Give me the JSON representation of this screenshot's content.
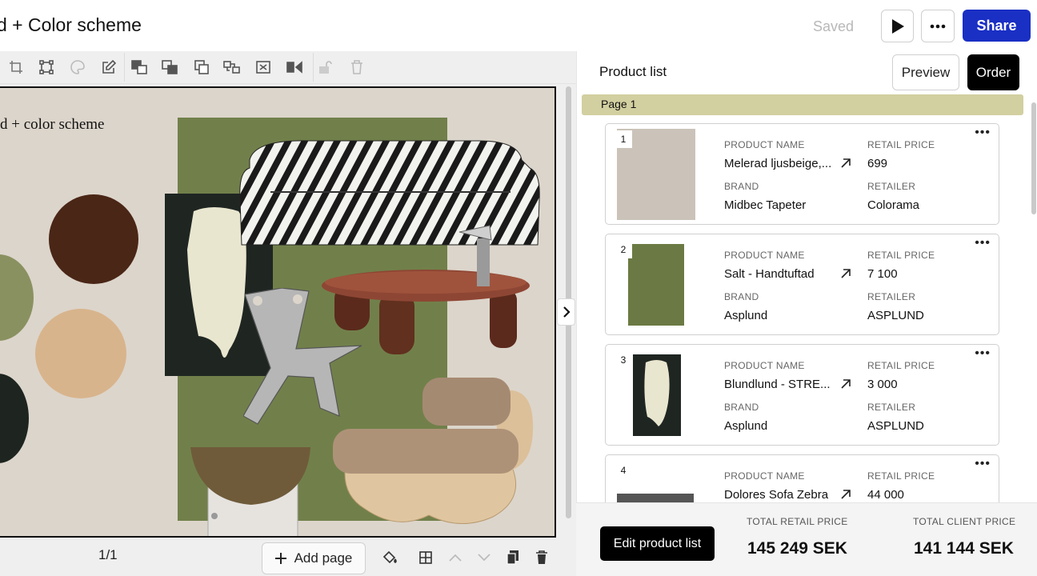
{
  "header": {
    "title": "d + Color scheme",
    "saved_label": "Saved",
    "share_label": "Share"
  },
  "toolbar": {
    "icons": [
      "crop-icon",
      "transform-icon",
      "palette-icon",
      "edit-icon",
      "bring-forward-icon",
      "send-backward-icon",
      "duplicate-icon",
      "group-icon",
      "fit-icon",
      "flip-icon",
      "lock-icon",
      "delete-icon"
    ]
  },
  "canvas": {
    "moodboard_title": "d + color scheme",
    "swatch_colors": [
      "#4a2616",
      "#8a9160",
      "#d8b48c",
      "#1e2520"
    ]
  },
  "footer_left": {
    "page_indicator": "1/1",
    "add_page_label": "Add page"
  },
  "product_panel": {
    "title": "Product list",
    "preview_label": "Preview",
    "order_label": "Order",
    "page_label": "Page 1",
    "labels": {
      "product_name": "PRODUCT NAME",
      "retail_price": "RETAIL PRICE",
      "brand": "BRAND",
      "retailer": "RETAILER"
    },
    "products": [
      {
        "index": "1",
        "name": "Melerad ljusbeige,...",
        "price": "699",
        "brand": "Midbec Tapeter",
        "retailer": "Colorama"
      },
      {
        "index": "2",
        "name": "Salt - Handtuftad",
        "price": "7 100",
        "brand": "Asplund",
        "retailer": "ASPLUND"
      },
      {
        "index": "3",
        "name": "Blundlund - STRE...",
        "price": "3 000",
        "brand": "Asplund",
        "retailer": "ASPLUND"
      },
      {
        "index": "4",
        "name": "Dolores Sofa Zebra",
        "price": "44 000",
        "brand": "",
        "retailer": ""
      }
    ]
  },
  "totals": {
    "edit_label": "Edit product list",
    "retail_label": "TOTAL RETAIL PRICE",
    "retail_value": "145 249 SEK",
    "client_label": "TOTAL CLIENT PRICE",
    "client_value": "141 144 SEK"
  }
}
